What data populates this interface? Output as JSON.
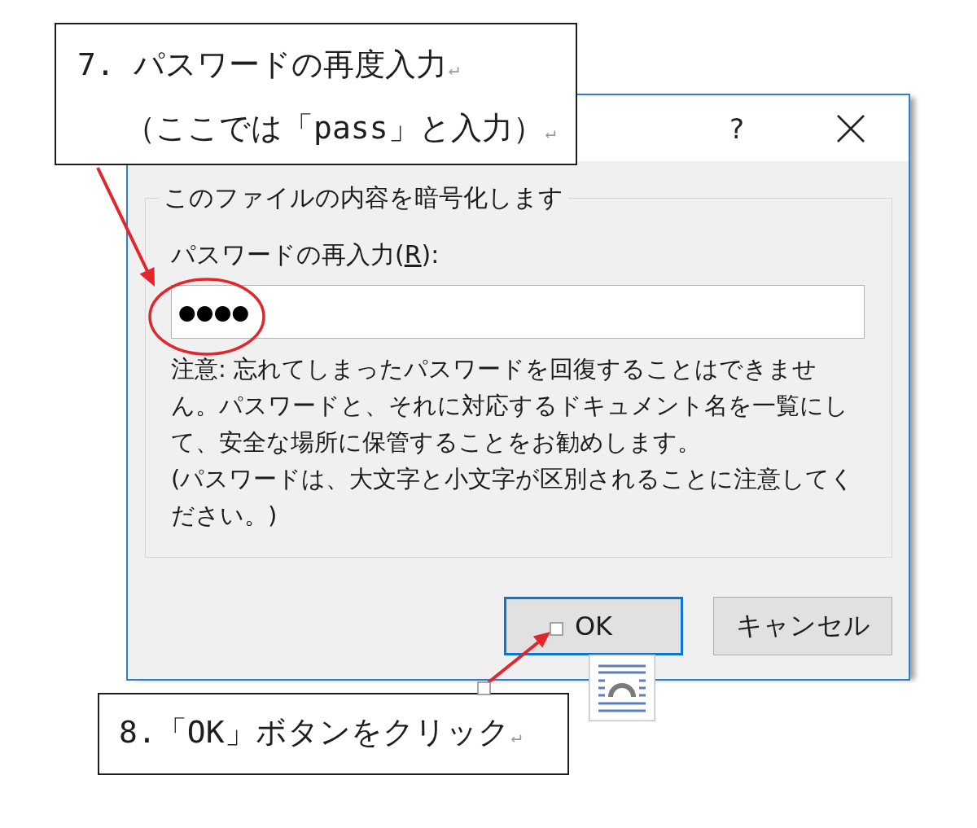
{
  "callouts": [
    {
      "lines": [
        {
          "text": "7. パスワードの再度入力",
          "mark": "↵"
        },
        {
          "text": "（ここでは「pass」と入力）",
          "mark": "↵"
        }
      ]
    },
    {
      "lines": [
        {
          "text": "8.「OK」ボタンをクリック",
          "mark": "↵"
        }
      ]
    }
  ],
  "dialog": {
    "help_button": "?",
    "group": {
      "title": "このファイルの内容を暗号化します",
      "field_label": {
        "before": "パスワードの再入力(",
        "access_key": "R",
        "after": "):"
      },
      "password_field": {
        "value": "●●●●"
      },
      "note": [
        "注意: 忘れてしまったパスワードを回復することはできません。パスワードと、それに対応するドキュメント名を一覧にして、安全な場所に保管することをお勧めします。",
        "(パスワードは、大文字と小文字が区別されることに注意してください。)"
      ]
    },
    "buttons": [
      {
        "label": "OK",
        "default": true
      },
      {
        "label": "キャンセル",
        "default": false
      }
    ]
  }
}
